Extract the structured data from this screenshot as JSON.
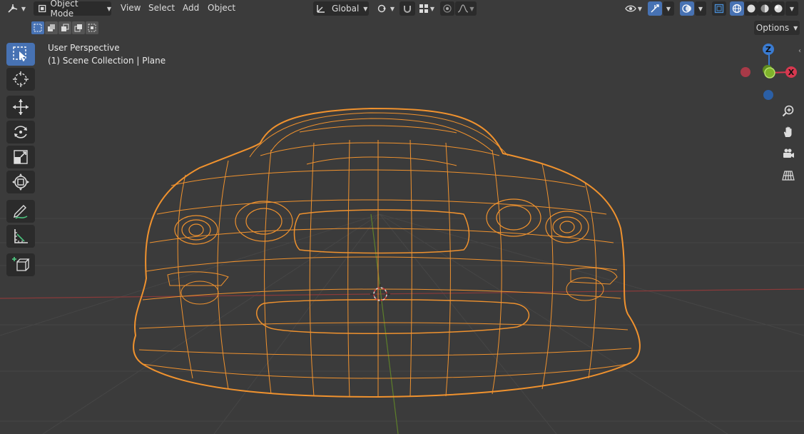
{
  "header": {
    "mode_label": "Object Mode",
    "menu": [
      "View",
      "Select",
      "Add",
      "Object"
    ],
    "orientation_label": "Global",
    "options_label": "Options"
  },
  "viewport": {
    "view_name": "User Perspective",
    "collection_info": "(1) Scene Collection | Plane"
  },
  "gizmo": {
    "z_label": "Z",
    "x_label": "X",
    "colors": {
      "x": "#d6384f",
      "y": "#7fb32b",
      "z": "#3a7bd1"
    }
  },
  "toolbar": {
    "tools": [
      "select-box-icon",
      "cursor-icon",
      "move-icon",
      "rotate-icon",
      "scale-icon",
      "transform-icon",
      "annotate-icon",
      "measure-icon",
      "add-cube-icon"
    ]
  },
  "colors": {
    "wireframe": "#f0922e",
    "active_accent": "#4772b3",
    "background": "#3b3b3b"
  }
}
